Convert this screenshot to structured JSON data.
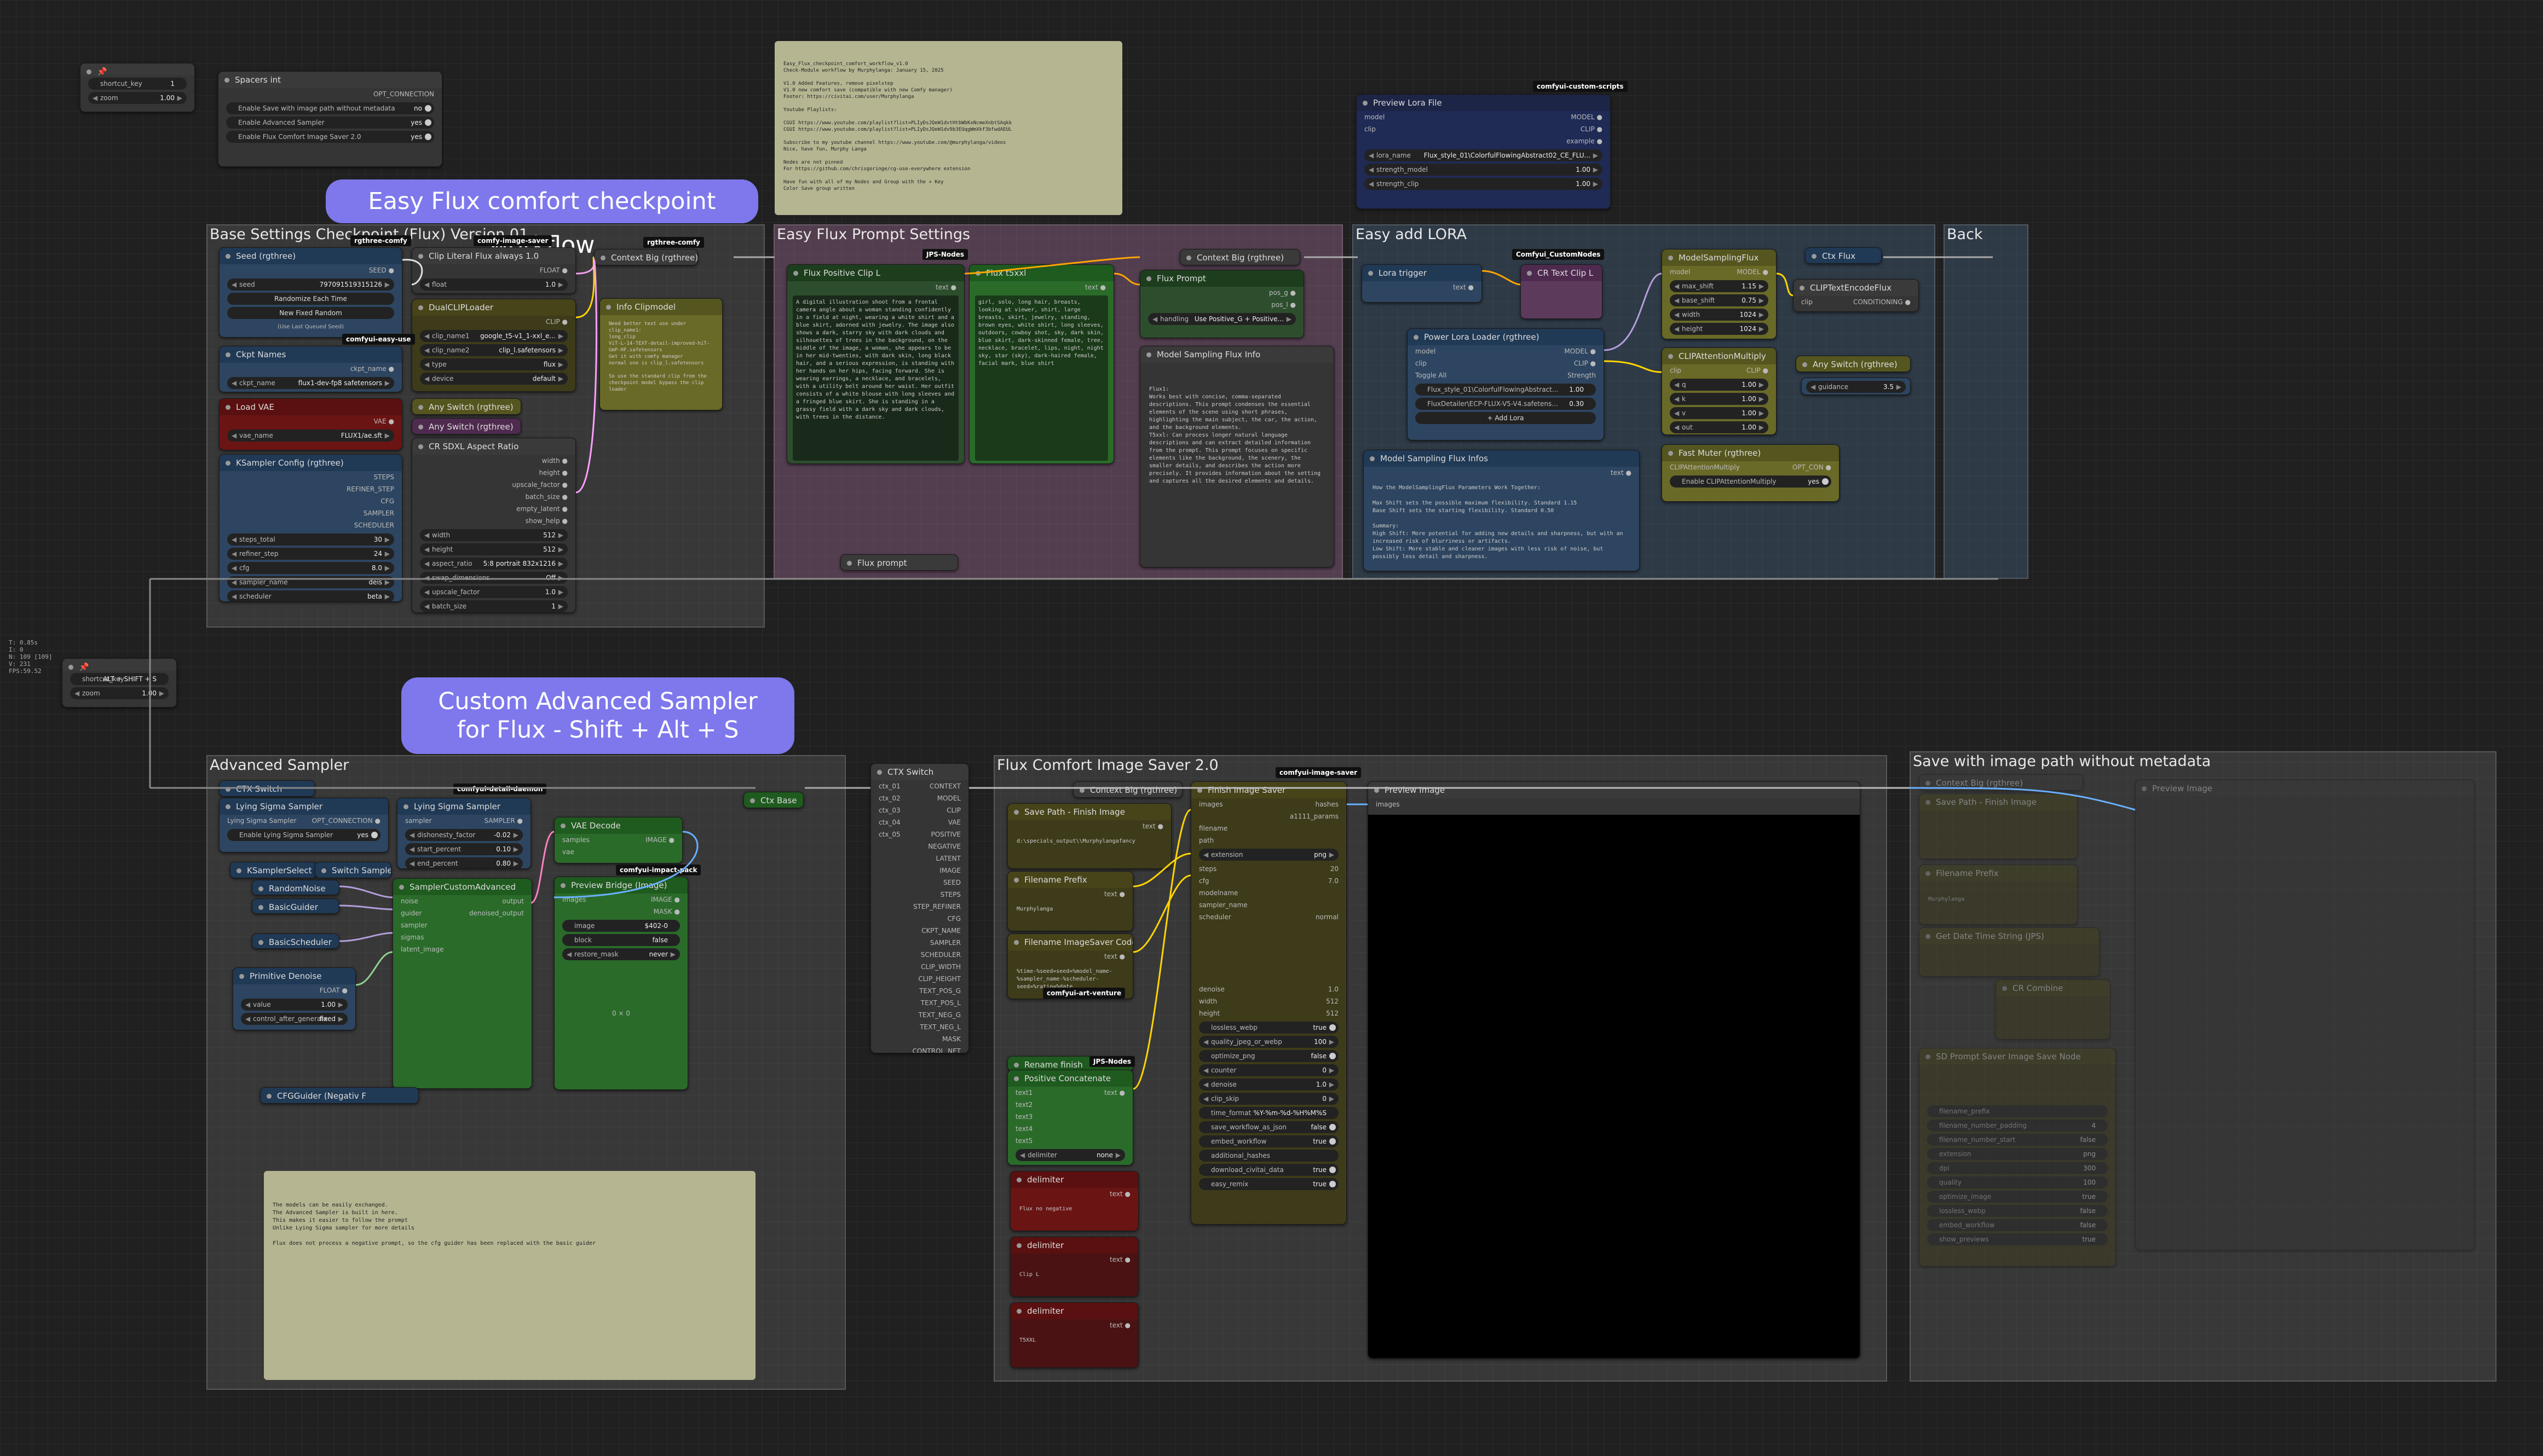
{
  "groups": {
    "base": "Base Settings Checkpoint (Flux) Version 01",
    "prompt": "Easy Flux Prompt Settings",
    "lora": "Easy add LORA",
    "back": "Back",
    "advanced": "Advanced Sampler",
    "saver": "Flux Comfort Image Saver 2.0",
    "nometa": "Save with image path  without metadata"
  },
  "banners": {
    "top": "Easy Flux comfort checkpoint workflow",
    "middle": "Custom Advanced  Sampler\nfor Flux - Shift + Alt + S"
  },
  "shortcut1": {
    "key_label": "shortcut_key",
    "key_value": "1",
    "zoom_label": "zoom",
    "zoom_value": "1.00"
  },
  "shortcut2": {
    "key_label": "shortcut_key",
    "key_value": "ALT + SHIFT + S",
    "zoom_label": "zoom",
    "zoom_value": "1.00"
  },
  "stats": [
    "T: 0.85s",
    "I: 0",
    "N: 109 [109]",
    "V: 231",
    "FPS:59.52"
  ],
  "spacer": {
    "title": "Spacers int",
    "output": "OPT_CONNECTION",
    "rows": [
      {
        "label": "Enable Save with image path  without metadata",
        "value": "no"
      },
      {
        "label": "Enable Advanced Sampler",
        "value": "yes"
      },
      {
        "label": "Enable Flux Comfort Image Saver 2.0",
        "value": "yes"
      }
    ]
  },
  "notes": {
    "top": "Easy_Flux_checkpoint_comfort_workflow_v1.0\nCheck-Module workflow by Murphylanga: January 15, 2025\n\nV1.0 Added Features, remove pixelstep\nV1.0 new comfort save (compatible with new Comfy manager)\nFooter: https://civitai.com/user/Murphylanga\n\nYoutube Playlists:\n\nCGUI https://www.youtube.com/playlist?list=PLIyDsJQeW1dvtHtbWbKxNcmeXnbtSAqkk\nCGUI https://www.youtube.com/playlist?list=PLIyDsJQeW1dv9b3EUqgWmXkf3bfwdAEUL\n\nSubscribe to my youtube channel https://www.youtube.com/@murphylanga/videos\nNice, have fun, Murphy Langa\n\nNodes are not pinned\nFor https://github.com/chrisgoringe/cg-use-everywhere extension\n\nHave fun with all of my Nodes and Group with the + Key\nColor Save group written",
    "clip_info": "Need better text use under\nclip_name1:\nlong_clip\nViT-L-14-TEXT-detail-improved-hiT-GmP-HF.safetensors\nGet it with comfy manager\nnormal use is clip_l.safetensors\n\nSo use the standard clip from the checkpoint model bypass the clip loader",
    "flux_info": "Flux1:\nWorks best with concise, comma-separated descriptions. This prompt condenses the essential elements of the scene using short phrases, highlighting the main subject, the car, the action, and the background elements.\nT5xxl: Can process longer natural language descriptions and can extract detailed information from the prompt. This prompt focuses on specific elements like the background, the scenery, the smaller details, and describes the action more precisely. It provides information about the setting and captures all the desired elements and details.",
    "model_info": "How the ModelSamplingFlux Parameters Work Together:\n\nMax Shift sets the possible maximum flexibility. Standard 1.15\nBase Shift sets the starting flexibility. Standard 0.50\n\nSummary:\nHigh Shift: More potential for adding new details and sharpness, but with an increased risk of blurriness or artifacts.\nLow Shift: More stable and cleaner images with less risk of noise, but possibly less detail and sharpness.",
    "adv": "The models can be easily exchanged.\nThe Advanced Sampler is built in here.\nThis makes it easier to follow the prompt\nUnlike Lying Sigma sampler for more details\n\nFlux does not process a negative prompt, so the cfg guider has been replaced with the basic guider"
  },
  "prompts": {
    "clip_l_title": "Flux Positive Clip L",
    "clip_l_text": "A digital illustration shoot from a frontal camera angle about a woman standing confidently in a field at night, wearing a white shirt and a blue skirt, adorned with jewelry. The image also shows a dark, starry sky with dark clouds and silhouettes of trees in the background, on the middle of the image, a woman, she appears to be in her mid-twenties, with dark skin, long black hair, and a serious expression, is standing with her hands on her hips, facing forward. She is wearing earrings, a necklace, and bracelets, with a utility belt around her waist. Her outfit consists of a white blouse with long sleeves and a fringed blue skirt. She is standing in a grassy field with a dark sky and dark clouds, with trees in the distance.",
    "t5_title": "Flux t5xxl",
    "t5_text": "girl, solo, long hair, breasts, looking at viewer, shirt, large breasts, skirt, jewelry, standing, brown eyes, white shirt, long sleeves, outdoors, cowboy shot, sky, dark skin, blue skirt, dark-skinned female, tree, necklace, bracelet, lips, night, night sky, star (sky), dark-haired female, facial mark, blue shirt",
    "flux_prompt_title": "Flux Prompt",
    "flux_prompt_handling": "Use Positive_G + Positive...",
    "flux_prompt_label": "handling",
    "flux_prompt_small": "Flux prompt"
  },
  "base": {
    "seed_title": "Seed (rgthree)",
    "seed_value": "797091519315126",
    "randomize": "Randomize Each Time",
    "new_random": "New Fixed Random",
    "last_seed": "(Use Last Queued Seed)",
    "ckpt_title": "Ckpt Names",
    "ckpt_value": "flux1-dev-fp8 safetensors",
    "vae_title": "Load VAE",
    "vae_value": "FLUX1/ae.sft",
    "ks_title": "KSampler Config (rgthree)",
    "ks_rows": [
      {
        "label": "steps_total",
        "value": "30"
      },
      {
        "label": "refiner_step",
        "value": "24"
      },
      {
        "label": "cfg",
        "value": "8.0"
      },
      {
        "label": "sampler_name",
        "value": "deis"
      },
      {
        "label": "scheduler",
        "value": "beta"
      }
    ],
    "ks_outputs": [
      "STEPS",
      "REFINER_STEP",
      "CFG",
      "SAMPLER",
      "SCHEDULER"
    ],
    "clipflux_title": "Clip Literal Flux always 1.0",
    "clipflux_value": "1.0",
    "dual_title": "DualCLIPLoader",
    "dual_rows": [
      {
        "label": "clip_name1",
        "value": "google_t5-v1_1-xxl_e..."
      },
      {
        "label": "clip_name2",
        "value": "clip_l.safetensors"
      },
      {
        "label": "type",
        "value": "flux"
      },
      {
        "label": "device",
        "value": "default"
      }
    ],
    "any1": "Any Switch (rgthree)",
    "any2": "Any Switch (rgthree)",
    "cr_title": "CR SDXL Aspect Ratio",
    "cr_rows": [
      {
        "label": "width",
        "value": "512"
      },
      {
        "label": "height",
        "value": "512"
      },
      {
        "label": "aspect_ratio",
        "value": "5:8 portrait 832x1216"
      },
      {
        "label": "swap_dimensions",
        "value": "Off"
      },
      {
        "label": "upscale_factor",
        "value": "1.0"
      },
      {
        "label": "batch_size",
        "value": "1"
      }
    ],
    "ctx_title": "Context Big (rgthree)",
    "info_title": "Info Clipmodel"
  },
  "lora": {
    "preview_title": "Preview Lora File",
    "preview_rows": [
      {
        "label": "lora_name",
        "value": "Flux_style_01\\ColorfulFlowingAbstract02_CE_FLU..."
      },
      {
        "label": "strength_model",
        "value": "1.00"
      },
      {
        "label": "strength_clip",
        "value": "1.00"
      }
    ],
    "power_title": "Power Lora Loader (rgthree)",
    "toggle": "Toggle All",
    "strength": "Strength",
    "loras": [
      {
        "name": "Flux_style_01\\ColorfulFlowingAbstract...",
        "value": "1.00"
      },
      {
        "name": "FluxDetailer\\ECP-FLUX-V5-V4.safetens...",
        "value": "0.30"
      }
    ],
    "add": "+ Add Lora",
    "trigger": "Lora trigger",
    "cr_text": "CR Text Clip L",
    "msf_title": "ModelSamplingFlux",
    "msf_rows": [
      {
        "label": "max_shift",
        "value": "1.15"
      },
      {
        "label": "base_shift",
        "value": "0.75"
      },
      {
        "label": "width",
        "value": "1024"
      },
      {
        "label": "height",
        "value": "1024"
      }
    ],
    "attn_title": "CLIPAttentionMultiply",
    "attn_rows": [
      {
        "label": "q",
        "value": "1.00"
      },
      {
        "label": "k",
        "value": "1.00"
      },
      {
        "label": "v",
        "value": "1.00"
      },
      {
        "label": "out",
        "value": "1.00"
      }
    ],
    "fast_title": "Fast Muter (rgthree)",
    "fast_row": "CLIPAttentionMultiply",
    "fast_enable": "Enable CLIPAttentionMultiply",
    "fast_val": "yes",
    "encode_title": "CLIPTextEncodeFlux",
    "anyswitch": "Any Switch (rgthree)",
    "guidance_label": "guidance",
    "guidance": "3.5",
    "ctx_flux": "Ctx Flux",
    "model_info_title": "Model Sampling Flux Infos"
  },
  "adv": {
    "ctx_switch": "CTX Switch",
    "lying1": "Lying Sigma Sampler",
    "lying1_row": "Lying Sigma Sampler",
    "enable_lying": "Enable Lying Sigma Sampler",
    "enable_lying_val": "yes",
    "lying2": "Lying Sigma Sampler",
    "lying2_rows": [
      {
        "label": "dishonesty_factor",
        "value": "-0.02"
      },
      {
        "label": "start_percent",
        "value": "0.10"
      },
      {
        "label": "end_percent",
        "value": "0.80"
      }
    ],
    "ksel": "KSamplerSelect",
    "switch_sampler": "Switch Sampler",
    "random_noise": "RandomNoise",
    "basic_guider": "BasicGuider",
    "basic_sched": "BasicScheduler",
    "sca_title": "SamplerCustomAdvanced",
    "sca_inputs": [
      "noise",
      "guider",
      "sampler",
      "sigmas",
      "latent_image"
    ],
    "sca_outputs": [
      "output",
      "denoised_output"
    ],
    "vae_decode": "VAE Decode",
    "preview_bridge": "Preview Bridge (Image)",
    "pb_rows": [
      {
        "label": "image",
        "value": "$402-0"
      },
      {
        "label": "block",
        "value": "false"
      },
      {
        "label": "restore_mask",
        "value": "never"
      }
    ],
    "pb_size": "0 × 0",
    "ctx_base": "Ctx Base",
    "prim_title": "Primitive Denoise",
    "prim_rows": [
      {
        "label": "value",
        "value": "1.00"
      },
      {
        "label": "control_after_generate",
        "value": "fixed"
      }
    ],
    "cfg_guider": "CFGGuider (Negativ F"
  },
  "ctx_switch": {
    "title": "CTX Switch",
    "inputs": [
      "ctx_01",
      "ctx_02",
      "ctx_03",
      "ctx_04",
      "ctx_05"
    ],
    "outputs": [
      "CONTEXT",
      "MODEL",
      "CLIP",
      "VAE",
      "POSITIVE",
      "NEGATIVE",
      "LATENT",
      "IMAGE",
      "SEED",
      "STEPS",
      "STEP_REFINER",
      "CFG",
      "CKPT_NAME",
      "SAMPLER",
      "SCHEDULER",
      "CLIP_WIDTH",
      "CLIP_HEIGHT",
      "TEXT_POS_G",
      "TEXT_POS_L",
      "TEXT_NEG_G",
      "TEXT_NEG_L",
      "MASK",
      "CONTROL_NET"
    ]
  },
  "saver": {
    "save_path": "Save Path - Finish Image",
    "save_path_val": "d:\\specials_output\\\\Murphylangafancy",
    "prefix": "Filename Prefix",
    "prefix_val": "Murphylanga",
    "code": "Filename ImageSaver Code",
    "code_val": "%time-%seed=seed=%model_name-%sampler_name-%scheduler-seed=%ratio=%date",
    "rename": "Rename finish",
    "pos_concat": "Positive Concatenate",
    "texts": [
      "text1",
      "text2",
      "text3",
      "text4",
      "text5"
    ],
    "delimiter_label": "delimiter",
    "delimiter_val": "none",
    "delims": [
      {
        "title": "delimiter",
        "text": "Flux no negative"
      },
      {
        "title": "delimiter",
        "text": "Clip L"
      },
      {
        "title": "delimiter",
        "text": "T5XXL"
      }
    ],
    "finish": "Finish Image Saver",
    "finish_out": [
      "hashes",
      "a1111_params"
    ],
    "finish_rows": [
      {
        "label": "extension",
        "value": "png"
      },
      {
        "label": "steps",
        "value": "20"
      },
      {
        "label": "cfg",
        "value": "7.0"
      },
      {
        "label": "modelname",
        "value": ""
      },
      {
        "label": "sampler_name",
        "value": ""
      },
      {
        "label": "scheduler",
        "value": "normal"
      }
    ],
    "finish_rows2": [
      {
        "label": "denoise",
        "value": "1.0"
      },
      {
        "label": "width",
        "value": "512"
      },
      {
        "label": "height",
        "value": "512"
      },
      {
        "label": "lossless_webp",
        "value": "true"
      },
      {
        "label": "quality_jpeg_or_webp",
        "value": "100"
      },
      {
        "label": "optimize_png",
        "value": "false"
      },
      {
        "label": "counter",
        "value": "0"
      },
      {
        "label": "denoise",
        "value": "1.0"
      },
      {
        "label": "clip_skip",
        "value": "0"
      },
      {
        "label": "time_format",
        "value": "%Y-%m-%d-%H%M%S"
      },
      {
        "label": "save_workflow_as_json",
        "value": "false"
      },
      {
        "label": "embed_workflow",
        "value": "true"
      },
      {
        "label": "additional_hashes",
        "value": ""
      },
      {
        "label": "download_civitai_data",
        "value": "true"
      },
      {
        "label": "easy_remix",
        "value": "true"
      }
    ],
    "preview": "Preview Image",
    "preview_in": "images"
  },
  "nometa": {
    "ctx": "Context Big (rgthree)",
    "save_path": "Save Path - Finish Image",
    "prefix": "Filename Prefix",
    "prefix_val": "Murphylanga",
    "date": "Get Date Time String (JPS)",
    "cr": "CR Combine",
    "sd": "SD Prompt Saver Image Save Node",
    "preview": "Preview Image",
    "rows": [
      {
        "label": "filename_prefix",
        "value": ""
      },
      {
        "label": "filename_number_padding",
        "value": "4"
      },
      {
        "label": "filename_number_start",
        "value": "false"
      },
      {
        "label": "extension",
        "value": "png"
      },
      {
        "label": "dpi",
        "value": "300"
      },
      {
        "label": "quality",
        "value": "100"
      },
      {
        "label": "optimize_image",
        "value": "true"
      },
      {
        "label": "lossless_webp",
        "value": "false"
      },
      {
        "label": "embed_workflow",
        "value": "false"
      },
      {
        "label": "show_previews",
        "value": "true"
      }
    ]
  },
  "tags": [
    "rgthree-comfy",
    "comfy-image-saver",
    "rgthree-comfy",
    "comfyui-easy-use",
    "JPS-Nodes",
    "comfyui-custom-scripts",
    "Comfyui_CustomNodes",
    "comfyui-detail-daemon",
    "comfyui-impact-pack",
    "comfyui-image-saver",
    "comfyui-art-venture",
    "JPS-Nodes"
  ]
}
